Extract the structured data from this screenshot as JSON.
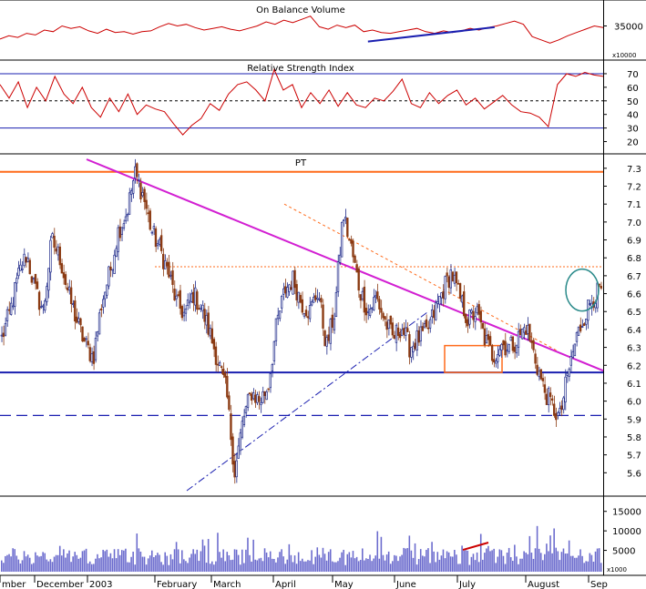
{
  "colors": {
    "up_candle": "#1f2a8a",
    "down_candle": "#8b3a12",
    "trendline": "#d21fd2",
    "support": "#1a1fb0",
    "resistance": "#ff6a1a",
    "obv_line": "#cc0000",
    "volume_bar": "#6a6acd",
    "circle": "#2a8a8a"
  },
  "chart_data": [
    {
      "id": "obv",
      "type": "line",
      "title": "On Balance Volume",
      "unit_label": "x10000",
      "y_ticks": [
        35000
      ],
      "ylim": [
        31500,
        37500
      ],
      "series": [
        {
          "values": [
            33400,
            33800,
            33600,
            34100,
            33900,
            34500,
            34300,
            35000,
            34700,
            34900,
            34400,
            34100,
            34600,
            34200,
            34300,
            34000,
            34300,
            34400,
            34900,
            35300,
            35000,
            35200,
            34800,
            34500,
            34700,
            34900,
            34600,
            34400,
            34700,
            35000,
            35500,
            35200,
            35700,
            35400,
            35800,
            36200,
            34900,
            34600,
            35100,
            34800,
            35100,
            34300,
            34500,
            34200,
            34100,
            34300,
            34500,
            34700,
            34300,
            34100,
            34400,
            34200,
            34400,
            34700,
            34500,
            34800,
            35000,
            35300,
            35600,
            35200,
            33700,
            33300,
            32900,
            33300,
            33800,
            34200,
            34600,
            35000,
            34800
          ]
        }
      ],
      "annotation_trend": {
        "x": [
          0.61,
          0.82
        ],
        "y": [
          33100,
          34850
        ]
      }
    },
    {
      "id": "rsi",
      "type": "line",
      "title": "Relative Strength Index",
      "y_ticks": [
        20,
        30,
        40,
        50,
        60,
        70
      ],
      "ylim": [
        15,
        76
      ],
      "solid_levels": [
        70,
        30
      ],
      "dashed_level": 50,
      "series": [
        {
          "values": [
            62,
            52,
            64,
            45,
            60,
            50,
            68,
            55,
            48,
            60,
            45,
            38,
            52,
            42,
            55,
            40,
            47,
            44,
            42,
            33,
            25,
            32,
            37,
            48,
            43,
            55,
            62,
            64,
            58,
            50,
            73,
            58,
            62,
            45,
            56,
            48,
            58,
            46,
            56,
            47,
            45,
            52,
            50,
            57,
            66,
            48,
            45,
            56,
            48,
            54,
            58,
            47,
            52,
            44,
            49,
            54,
            47,
            42,
            41,
            38,
            31,
            62,
            70,
            68,
            71,
            69,
            68
          ]
        }
      ]
    },
    {
      "id": "pt",
      "type": "candlestick",
      "title": "PT",
      "y_ticks": [
        5.6,
        5.7,
        5.8,
        5.9,
        6.0,
        6.1,
        6.2,
        6.3,
        6.4,
        6.5,
        6.6,
        6.7,
        6.8,
        6.9,
        7.0,
        7.1,
        7.2,
        7.3
      ],
      "ylim": [
        5.5,
        7.35
      ],
      "horizontal_levels": [
        {
          "value": 7.28,
          "style": "resistance"
        },
        {
          "value": 6.16,
          "style": "support"
        },
        {
          "value": 5.92,
          "style": "support-dashed"
        }
      ],
      "closes": [
        6.35,
        6.5,
        6.7,
        6.82,
        6.62,
        6.5,
        6.9,
        6.8,
        6.6,
        6.45,
        6.32,
        6.24,
        6.55,
        6.72,
        6.95,
        7.05,
        7.27,
        7.15,
        6.95,
        6.85,
        6.72,
        6.55,
        6.48,
        6.6,
        6.52,
        6.38,
        6.22,
        6.05,
        5.6,
        5.9,
        6.05,
        6.0,
        6.08,
        6.42,
        6.62,
        6.68,
        6.55,
        6.5,
        6.62,
        6.3,
        6.5,
        7.05,
        6.85,
        6.62,
        6.5,
        6.58,
        6.45,
        6.35,
        6.42,
        6.3,
        6.35,
        6.38,
        6.5,
        6.62,
        6.72,
        6.58,
        6.45,
        6.5,
        6.35,
        6.25,
        6.32,
        6.3,
        6.35,
        6.42,
        6.25,
        6.08,
        5.98,
        5.9,
        6.15,
        6.35,
        6.48,
        6.58,
        6.62
      ]
    },
    {
      "id": "volume",
      "type": "bar",
      "unit_label": "x1000",
      "y_ticks": [
        5000,
        10000,
        15000
      ],
      "ylim": [
        0,
        17500
      ],
      "x_labels": [
        "mber",
        "December",
        "2003",
        "February",
        "March",
        "April",
        "May",
        "June",
        "July",
        "August",
        "Sep"
      ]
    }
  ]
}
